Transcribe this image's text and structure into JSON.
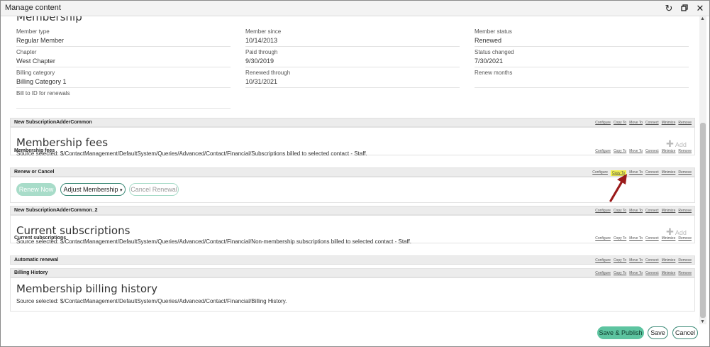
{
  "window": {
    "title": "Manage content",
    "refresh_icon": "refresh-icon",
    "restore_icon": "restore-window-icon",
    "close_icon": "close-icon"
  },
  "membership": {
    "heading": "Membership",
    "fields": {
      "member_type": {
        "label": "Member type",
        "value": "Regular Member"
      },
      "chapter": {
        "label": "Chapter",
        "value": "West Chapter"
      },
      "billing_category": {
        "label": "Billing category",
        "value": "Billing Category 1"
      },
      "bill_to": {
        "label": "Bill to ID for renewals",
        "value": ""
      },
      "member_since": {
        "label": "Member since",
        "value": "10/14/2013"
      },
      "paid_through": {
        "label": "Paid through",
        "value": "9/30/2019"
      },
      "renewed_through": {
        "label": "Renewed through",
        "value": "10/31/2021"
      },
      "member_status": {
        "label": "Member status",
        "value": "Renewed"
      },
      "status_changed": {
        "label": "Status changed",
        "value": "7/30/2021"
      },
      "renew_months": {
        "label": "Renew months",
        "value": ""
      }
    }
  },
  "panel_links": [
    "Configure",
    "Copy To",
    "Move To",
    "Connect",
    "Minimize",
    "Remove"
  ],
  "panels": {
    "adder_common": {
      "title": "New SubscriptionAdderCommon"
    },
    "fees": {
      "title": "Membership fees",
      "heading": "Membership fees",
      "add_label": "Add",
      "source": "Source selected: $/ContactManagement/DefaultSystem/Queries/Advanced/Contact/Financial/Subscriptions billed to selected contact - Staff."
    },
    "renew": {
      "title": "Renew or Cancel",
      "renew_now": "Renew Now",
      "adjust": "Adjust Membership",
      "cancel_renewal": "Cancel Renewal"
    },
    "adder_common_2": {
      "title": "New SubscriptionAdderCommon_2"
    },
    "current": {
      "title": "Current subscriptions",
      "heading": "Current subscriptions",
      "add_label": "Add",
      "source": "Source selected: $/ContactManagement/DefaultSystem/Queries/Advanced/Contact/Financial/Non-membership subscriptions billed to selected contact - Staff."
    },
    "auto_renewal": {
      "title": "Automatic renewal"
    },
    "billing_history": {
      "title": "Billing History",
      "heading": "Membership billing history",
      "source": "Source selected: $/ContactManagement/DefaultSystem/Queries/Advanced/Contact/Financial/Billing History."
    }
  },
  "footer": {
    "save_publish": "Save & Publish",
    "save": "Save",
    "cancel": "Cancel"
  },
  "colors": {
    "accent_green": "#5dc4a0",
    "highlight_yellow": "#f3f04a",
    "arrow_red": "#9b1b1b"
  }
}
